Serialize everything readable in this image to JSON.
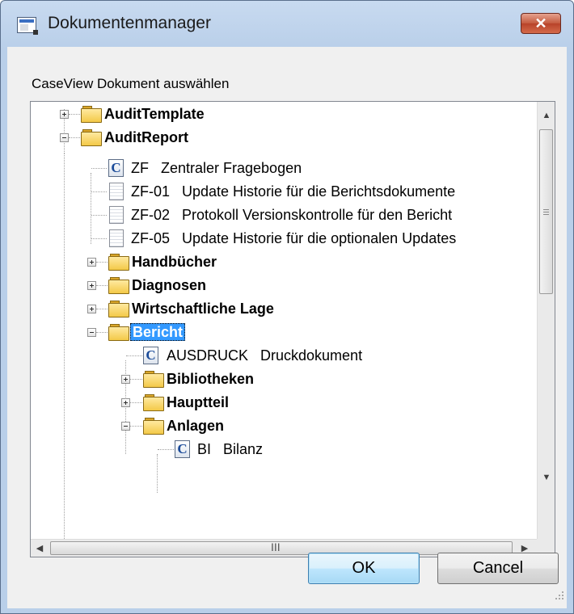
{
  "window": {
    "title": "Dokumentenmanager",
    "close_glyph": "✕",
    "icon": "application-window-icon"
  },
  "dialog": {
    "label": "CaseView Dokument auswählen"
  },
  "tree": {
    "selected": "Bericht",
    "nodes": [
      {
        "label": "AuditTemplate",
        "kind": "folder",
        "expander": "plus"
      },
      {
        "label": "AuditReport",
        "kind": "folder",
        "expander": "minus"
      },
      {
        "label": "ZF   Zentraler Fragebogen",
        "kind": "caseview-doc"
      },
      {
        "label": "ZF-01   Update Historie für die Berichtsdokumente",
        "kind": "text-doc"
      },
      {
        "label": "ZF-02   Protokoll Versionskontrolle für den Bericht",
        "kind": "text-doc"
      },
      {
        "label": "ZF-05   Update Historie für die optionalen Updates",
        "kind": "text-doc"
      },
      {
        "label": "Handbücher",
        "kind": "folder",
        "expander": "plus"
      },
      {
        "label": "Diagnosen",
        "kind": "folder",
        "expander": "plus"
      },
      {
        "label": "Wirtschaftliche Lage",
        "kind": "folder",
        "expander": "plus"
      },
      {
        "label": "Bericht",
        "kind": "folder",
        "expander": "minus",
        "selected": true
      },
      {
        "label": "AUSDRUCK   Druckdokument",
        "kind": "caseview-doc"
      },
      {
        "label": "Bibliotheken",
        "kind": "folder",
        "expander": "plus"
      },
      {
        "label": "Hauptteil",
        "kind": "folder",
        "expander": "plus"
      },
      {
        "label": "Anlagen",
        "kind": "folder",
        "expander": "minus"
      },
      {
        "label": "BI   Bilanz",
        "kind": "caseview-doc"
      }
    ]
  },
  "scrollbars": {
    "up_arrow": "▲",
    "down_arrow": "▼",
    "left_arrow": "◀",
    "right_arrow": "▶",
    "grip": "III",
    "vertical_position": 0.0
  },
  "buttons": {
    "ok_label": "OK",
    "cancel_label": "Cancel"
  },
  "icons": [
    "application-window-icon",
    "close-icon",
    "folder-icon",
    "caseview-document-icon",
    "text-document-icon",
    "expand-icon",
    "collapse-icon",
    "size-grip-icon"
  ],
  "colors": {
    "selection": "#3399ff",
    "title_bar": "#b9cfe9",
    "close_button": "#c45a3e"
  }
}
